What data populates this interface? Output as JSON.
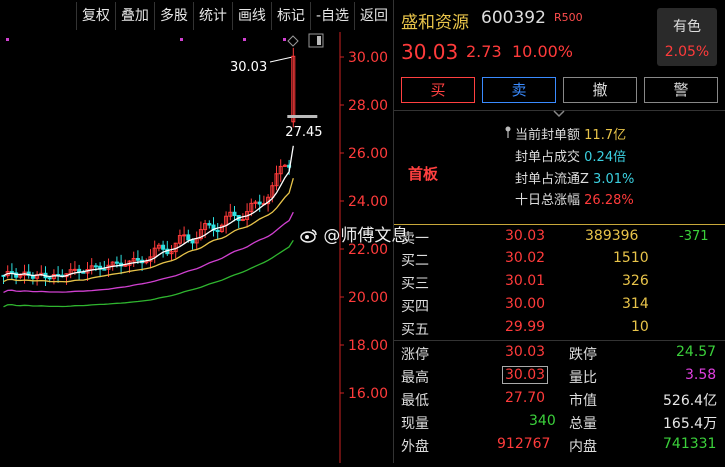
{
  "toolbar": {
    "items": [
      "复权",
      "叠加",
      "多股",
      "统计",
      "画线",
      "标记",
      "-自选",
      "返回"
    ]
  },
  "stock": {
    "name": "盛和资源",
    "code": "600392",
    "badge": "R500",
    "price": "30.03",
    "change": "2.73",
    "change_pct": "10.00%",
    "color_label": "有色",
    "color_pct": "2.05%"
  },
  "actions": {
    "buy": "买",
    "sell": "卖",
    "cancel": "撤",
    "alert": "警"
  },
  "seal": {
    "head": "首板",
    "current_amount_label": "当前封单额",
    "current_amount_value": "11.7亿",
    "ratio_turnover_label": "封单占成交",
    "ratio_turnover_value": "0.24倍",
    "ratio_float_label": "封单占流通Z",
    "ratio_float_value": "3.01%",
    "ten_day_label": "十日总涨幅",
    "ten_day_value": "26.28%"
  },
  "orderbook": {
    "sell1_label": "卖一",
    "sell1_price": "30.03",
    "sell1_vol": "389396",
    "sell1_diff": "-371",
    "buys": [
      {
        "label": "买二",
        "price": "30.02",
        "vol": "1510"
      },
      {
        "label": "买三",
        "price": "30.01",
        "vol": "326"
      },
      {
        "label": "买四",
        "price": "30.00",
        "vol": "314"
      },
      {
        "label": "买五",
        "price": "29.99",
        "vol": "10"
      }
    ]
  },
  "stats": {
    "limit_up_label": "涨停",
    "limit_up": "30.03",
    "limit_down_label": "跌停",
    "limit_down": "24.57",
    "high_label": "最高",
    "high": "30.03",
    "vol_ratio_label": "量比",
    "vol_ratio": "3.58",
    "low_label": "最低",
    "low": "27.70",
    "mcap_label": "市值",
    "mcap": "526.4亿",
    "current_vol_label": "现量",
    "current_vol": "340",
    "total_vol_label": "总量",
    "total_vol": "165.4万",
    "outer_label": "外盘",
    "outer": "912767",
    "inner_label": "内盘",
    "inner": "741331"
  },
  "chart": {
    "y_ticks": [
      "30.00",
      "28.00",
      "26.00",
      "24.00",
      "22.00",
      "20.00",
      "18.00",
      "16.00"
    ],
    "annotation_high": "30.03",
    "annotation_low": "27.45"
  },
  "watermark": "@师傅文息"
}
